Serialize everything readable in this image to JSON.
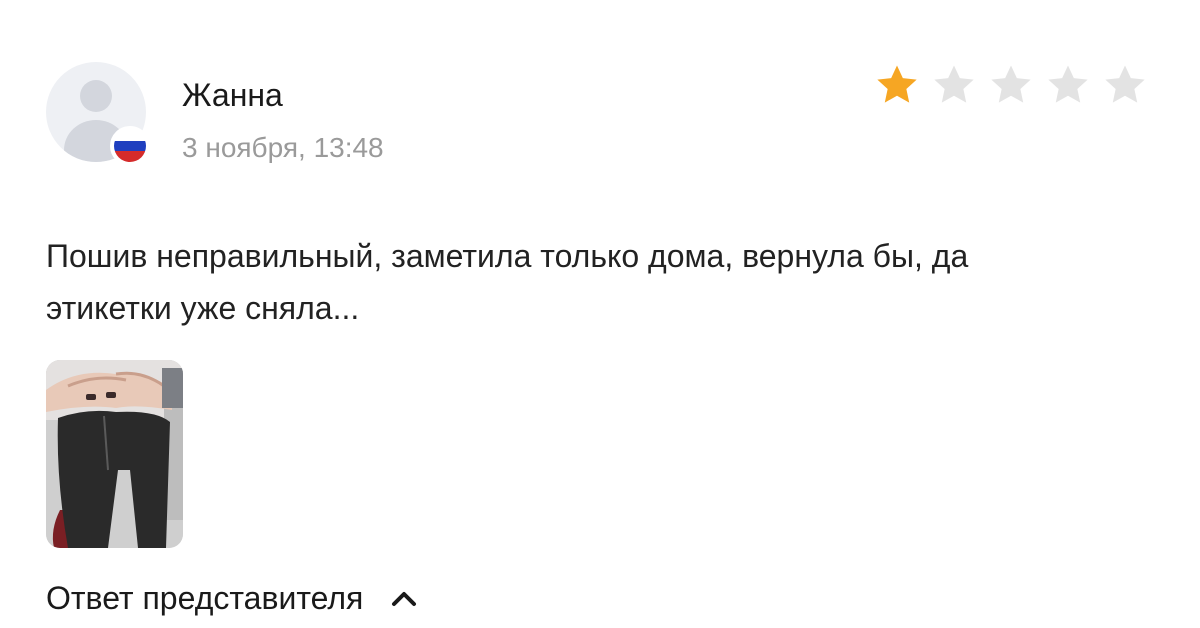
{
  "review": {
    "author": "Жанна",
    "date": "3 ноября, 13:48",
    "rating": 1,
    "max_rating": 5,
    "text": "Пошив неправильный, заметила только дома, вернула бы, да этикетки уже сняла...",
    "reply_toggle_label": "Ответ представителя",
    "avatar_flag": "russia-flag-icon",
    "colors": {
      "star_filled": "#f6a623",
      "star_empty": "#e3e3e3",
      "muted_text": "#9a9a9a"
    }
  }
}
